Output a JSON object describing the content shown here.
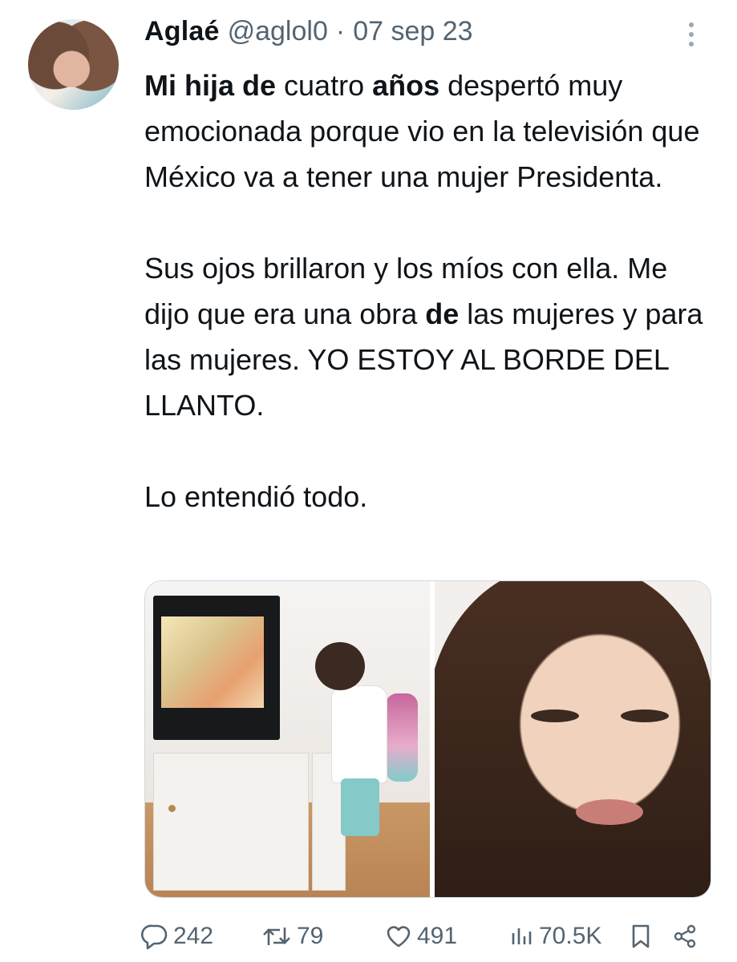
{
  "tweet": {
    "author_name": "Aglaé",
    "handle": "@aglol0",
    "separator": "·",
    "date": "07 sep 23",
    "paragraphs": [
      {
        "segments": [
          {
            "text": "Mi hija de",
            "bold": true
          },
          {
            "text": " cuatro ",
            "bold": false
          },
          {
            "text": "años",
            "bold": true
          },
          {
            "text": " despertó muy emocionada porque vio en la televisión que México va a tener una mujer Presidenta.",
            "bold": false
          }
        ]
      },
      {
        "segments": [
          {
            "text": "Sus ojos brillaron y los míos con ella. Me dijo que era una obra ",
            "bold": false
          },
          {
            "text": "de",
            "bold": true
          },
          {
            "text": " las mujeres y para las mujeres. YO ESTOY AL BORDE DEL LLANTO.",
            "bold": false
          }
        ]
      },
      {
        "segments": [
          {
            "text": "Lo entendió todo.",
            "bold": false
          }
        ]
      }
    ]
  },
  "actions": {
    "replies": "242",
    "retweets": "79",
    "likes": "491",
    "views": "70.5K"
  },
  "colors": {
    "text": "#0f1419",
    "muted": "#536471",
    "border": "#cfd9de"
  }
}
